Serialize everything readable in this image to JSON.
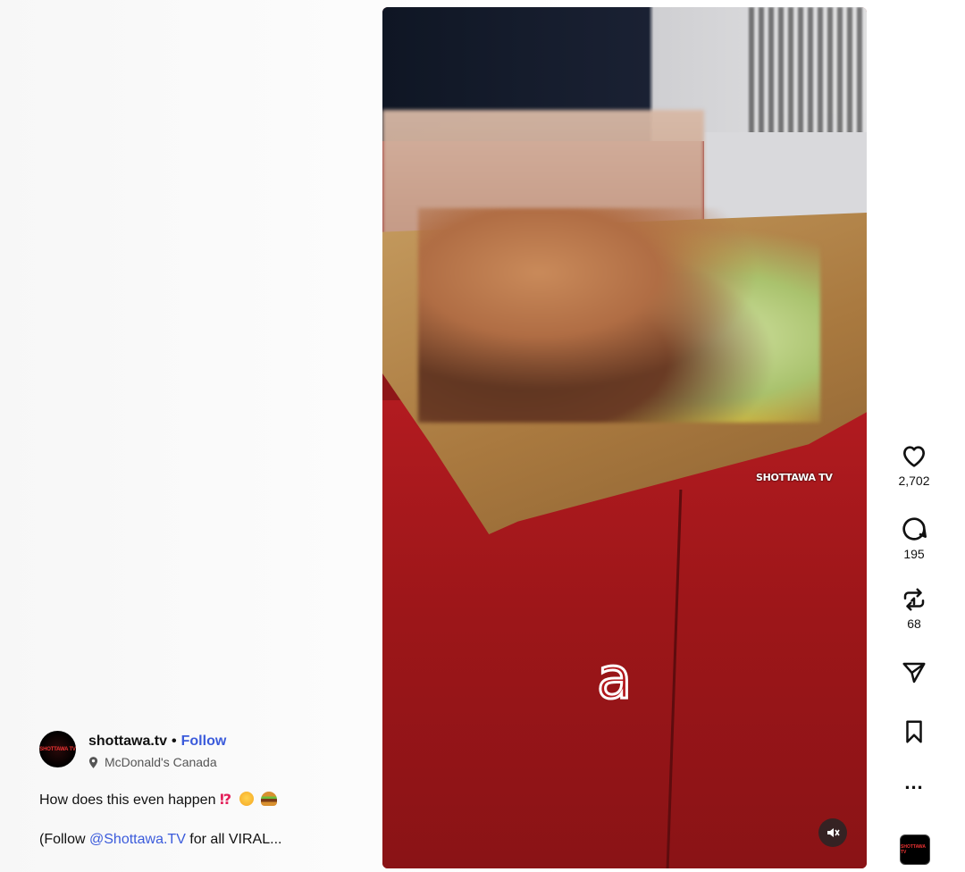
{
  "post": {
    "username": "shottawa.tv",
    "separator": "•",
    "follow_label": "Follow",
    "location": "McDonald's Canada",
    "avatar_text": "SHOTTAWA TV",
    "caption_text": "How does this even happen",
    "caption_emoji_1": "⁉",
    "caption_more_prefix": "(Follow ",
    "caption_mention": "@Shottawa.TV",
    "caption_more_suffix": " for all VIRAL..."
  },
  "video": {
    "watermark": "SHOTTAWA TV",
    "overlay_letter": "a",
    "muted": true
  },
  "actions": {
    "like_count": "2,702",
    "comment_count": "195",
    "repost_count": "68",
    "more_label": "...",
    "audio_thumb_text": "SHOTTAWA TV"
  },
  "colors": {
    "accent_link": "#3b5bdb",
    "counter_red": "#9d1619"
  },
  "icons": {
    "like": "heart-icon",
    "comment": "comment-icon",
    "repost": "repost-icon",
    "share": "share-icon",
    "save": "bookmark-icon",
    "mute": "speaker-muted-icon",
    "location": "map-pin-icon"
  }
}
